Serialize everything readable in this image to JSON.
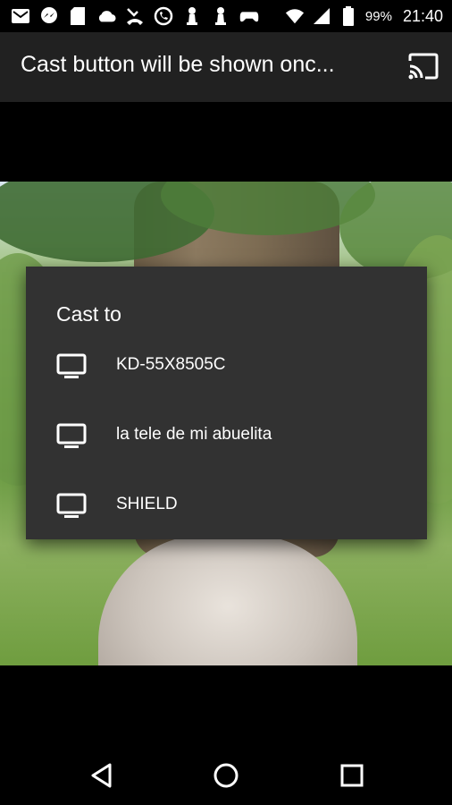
{
  "status_bar": {
    "left_icons": [
      "gmail-icon",
      "messenger-icon",
      "sd-card-icon",
      "cloud-icon",
      "missed-call-icon",
      "whatsapp-icon",
      "chess-pawn-icon",
      "chess-pawn-icon-2",
      "gamepad-icon"
    ],
    "right_icons": [
      "wifi-icon",
      "signal-icon",
      "battery-icon"
    ],
    "battery": "99%",
    "time": "21:40"
  },
  "toolbar": {
    "title": "Cast button will be shown onc..."
  },
  "dialog": {
    "title": "Cast to",
    "devices": [
      {
        "name": "KD-55X8505C"
      },
      {
        "name": "la tele de mi abuelita"
      },
      {
        "name": "SHIELD"
      }
    ]
  },
  "nav": {
    "back": "back-icon",
    "home": "home-icon",
    "recents": "recents-icon"
  }
}
